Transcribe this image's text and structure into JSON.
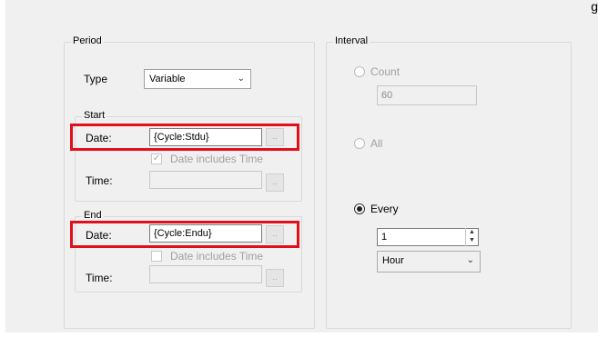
{
  "corner_text": "g",
  "period": {
    "legend": "Period",
    "type_label": "Type",
    "type_value": "Variable",
    "start": {
      "legend": "Start",
      "date_label": "Date:",
      "date_value": "{Cycle:Stdu}",
      "includes_time_label": "Date includes Time",
      "includes_time_checked": true,
      "time_label": "Time:",
      "time_value": "",
      "ellipsis": ".."
    },
    "end": {
      "legend": "End",
      "date_label": "Date:",
      "date_value": "{Cycle:Endu}",
      "includes_time_label": "Date includes Time",
      "includes_time_checked": false,
      "time_label": "Time:",
      "time_value": "",
      "ellipsis": ".."
    }
  },
  "interval": {
    "legend": "Interval",
    "count_label": "Count",
    "count_value": "60",
    "all_label": "All",
    "every_label": "Every",
    "every_value": "1",
    "unit_value": "Hour",
    "selected": "Every"
  },
  "colors": {
    "highlight": "#e0101b",
    "panel": "#f0f0f0"
  }
}
